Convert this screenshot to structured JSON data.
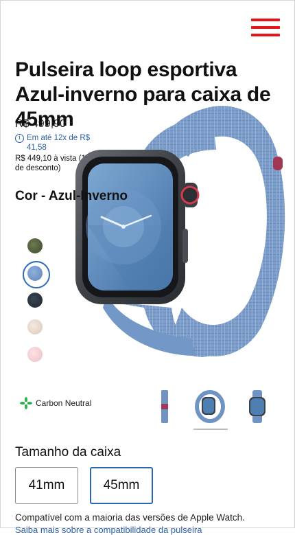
{
  "header": {
    "menu_icon": "hamburger-icon",
    "accent": "#e8141c"
  },
  "product": {
    "title": "Pulseira loop esportiva Azul-inverno para caixa de 45mm",
    "price": "R$ 499,90",
    "installments": "Em até 12x de R$ 41,58",
    "cash_price": "R$ 449,10 à vista (10% de desconto)"
  },
  "color": {
    "heading": "Cor - Azul-Inverno",
    "swatches": [
      {
        "name": "green",
        "hex": "#4a5a36",
        "selected": false
      },
      {
        "name": "blue",
        "hex": "#6f94c4",
        "selected": true
      },
      {
        "name": "navy",
        "hex": "#26303d",
        "selected": false
      },
      {
        "name": "beige",
        "hex": "#e8d8cc",
        "selected": false
      },
      {
        "name": "pink",
        "hex": "#f3cfd1",
        "selected": false
      }
    ]
  },
  "badge": {
    "label": "Carbon Neutral",
    "icon": "carbon-neutral-icon",
    "color": "#2bb24c"
  },
  "gallery": {
    "thumbnails": [
      "band-side-view",
      "band-loop-view",
      "watch-front-view"
    ],
    "selected_index": 1
  },
  "size": {
    "heading": "Tamanho da caixa",
    "options": [
      {
        "label": "41mm",
        "selected": false
      },
      {
        "label": "45mm",
        "selected": true
      }
    ]
  },
  "compat": {
    "text": "Compatível com a maioria das versões de Apple Watch.",
    "link": "Saiba mais sobre a compatibilidade da pulseira"
  }
}
